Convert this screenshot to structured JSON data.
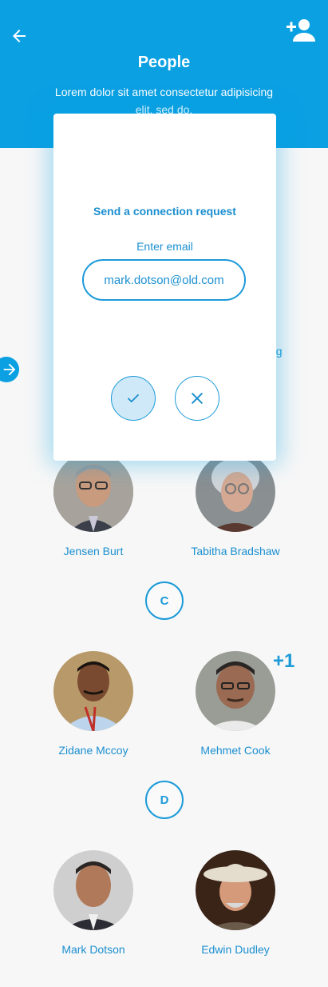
{
  "header": {
    "title": "People",
    "subtitle": "Lorem dolor sit amet consectetur adipisicing elit, sed do.",
    "back_icon": "arrow-left-icon",
    "add_icon": "add-user-icon"
  },
  "behind": {
    "peek_text": "ng"
  },
  "people": [
    {
      "name": "Jensen Burt"
    },
    {
      "name": "Tabitha Bradshaw"
    },
    {
      "name": "Zidane Mccoy"
    },
    {
      "name": "Mehmet Cook"
    },
    {
      "name": "Mark Dotson"
    },
    {
      "name": "Edwin Dudley"
    }
  ],
  "sections": [
    "C",
    "D"
  ],
  "badge": "+1",
  "modal": {
    "title": "Send a connection request",
    "label": "Enter email",
    "email_value": "mark.dotson@old.com",
    "confirm_icon": "check-icon",
    "cancel_icon": "close-icon"
  },
  "colors": {
    "primary": "#0aa0e2",
    "text_blue": "#1b8fd0",
    "confirm_bg": "#cfe9f8"
  }
}
